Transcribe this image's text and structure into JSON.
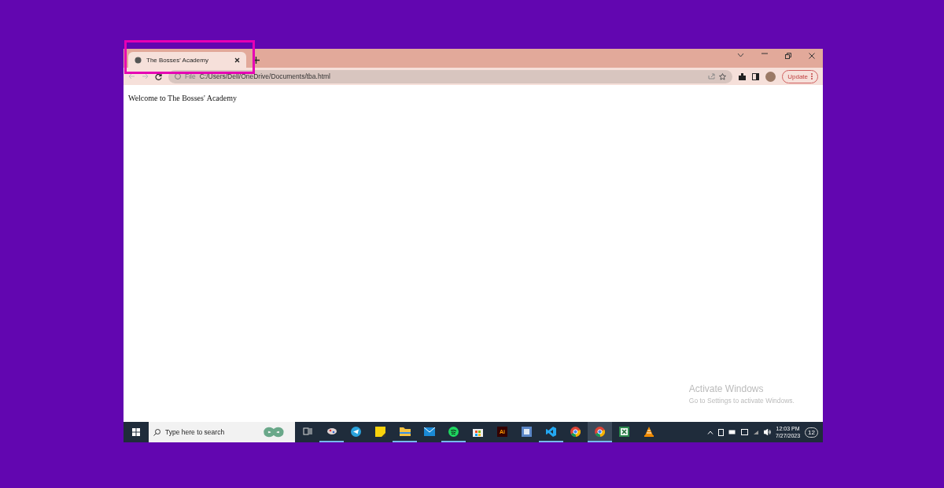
{
  "browser": {
    "tabs": [
      {
        "title": "The Bosses' Academy",
        "selected": true
      }
    ],
    "address": {
      "scheme": "File",
      "path": "C:/Users/Dell/OneDrive/Documents/tba.html"
    },
    "update_button": "Update"
  },
  "page": {
    "text": "Welcome to The Bosses' Academy"
  },
  "activation_notice": {
    "title": "Activate Windows",
    "subtitle": "Go to Settings to activate Windows."
  },
  "taskbar": {
    "search": {
      "placeholder": "Type here to search"
    },
    "apps": [
      {
        "kind": "taskview",
        "running": false,
        "selected": false
      },
      {
        "kind": "paint",
        "running": true,
        "selected": false
      },
      {
        "kind": "telegram",
        "running": false,
        "selected": false
      },
      {
        "kind": "notes",
        "running": false,
        "selected": false
      },
      {
        "kind": "folder",
        "running": true,
        "selected": false
      },
      {
        "kind": "mail",
        "running": false,
        "selected": false
      },
      {
        "kind": "spotify",
        "running": true,
        "selected": false
      },
      {
        "kind": "store",
        "running": false,
        "selected": false
      },
      {
        "kind": "illustrator",
        "label": "Ai",
        "running": false,
        "selected": false
      },
      {
        "kind": "word",
        "running": false,
        "selected": false
      },
      {
        "kind": "vscode",
        "running": true,
        "selected": false
      },
      {
        "kind": "chrome",
        "running": false,
        "selected": false
      },
      {
        "kind": "chrome",
        "running": true,
        "selected": true
      },
      {
        "kind": "excel",
        "running": false,
        "selected": false
      },
      {
        "kind": "vlc",
        "running": false,
        "selected": false
      }
    ],
    "time": "12:03 PM",
    "date": "7/27/2023",
    "notifications": "12"
  }
}
